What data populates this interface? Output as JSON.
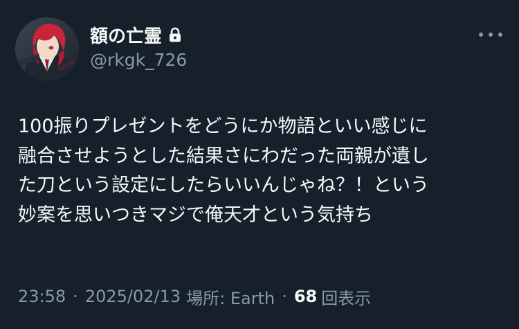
{
  "user": {
    "display_name": "額の亡霊",
    "handle": "@rkgk_726",
    "protected": true,
    "avatar_icon": "profile-avatar-icon",
    "lock_icon": "lock-icon"
  },
  "tweet": {
    "text_lines": [
      "100振りプレゼントをどうにか物語といい感じに",
      "融合させようとした結果さにわだった両親が遺し",
      "た刀という設定にしたらいいんじゃね？！という",
      "妙案を思いつきマジで俺天才という気持ち"
    ]
  },
  "meta": {
    "time": "23:58",
    "separator": "·",
    "date": "2025/02/13",
    "location": "場所: Earth",
    "views_count": "68",
    "views_label": "回表示"
  },
  "actions": {
    "more_icon": "more-icon"
  },
  "colors": {
    "background": "#15202b",
    "primary_text": "#f7f9f9",
    "secondary_text": "#8b98a5"
  }
}
